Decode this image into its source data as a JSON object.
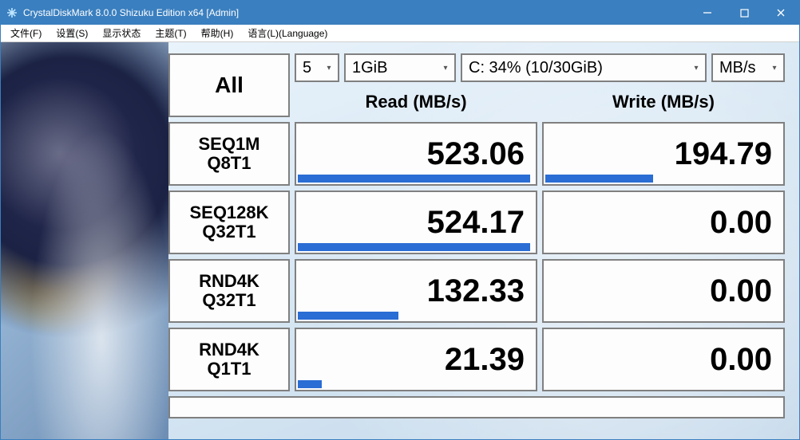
{
  "window": {
    "title": "CrystalDiskMark 8.0.0 Shizuku Edition x64 [Admin]"
  },
  "menus": {
    "file": "文件(F)",
    "settings": "设置(S)",
    "display": "显示状态",
    "theme": "主题(T)",
    "help": "帮助(H)",
    "language": "语言(L)(Language)"
  },
  "controls": {
    "all": "All",
    "runs": "5",
    "size": "1GiB",
    "drive": "C: 34% (10/30GiB)",
    "unit": "MB/s"
  },
  "headers": {
    "read": "Read (MB/s)",
    "write": "Write (MB/s)"
  },
  "tests": [
    {
      "label1": "SEQ1M",
      "label2": "Q8T1",
      "read": "523.06",
      "write": "194.79",
      "rbar": 97,
      "wbar": 45
    },
    {
      "label1": "SEQ128K",
      "label2": "Q32T1",
      "read": "524.17",
      "write": "0.00",
      "rbar": 97,
      "wbar": 0
    },
    {
      "label1": "RND4K",
      "label2": "Q32T1",
      "read": "132.33",
      "write": "0.00",
      "rbar": 42,
      "wbar": 0
    },
    {
      "label1": "RND4K",
      "label2": "Q1T1",
      "read": "21.39",
      "write": "0.00",
      "rbar": 10,
      "wbar": 0
    }
  ],
  "chart_data": {
    "type": "table",
    "title": "CrystalDiskMark 8.0.0 Benchmark Results",
    "drive": "C: 34% (10/30GiB)",
    "runs": 5,
    "test_size": "1GiB",
    "unit": "MB/s",
    "columns": [
      "Test",
      "Read (MB/s)",
      "Write (MB/s)"
    ],
    "rows": [
      [
        "SEQ1M Q8T1",
        523.06,
        194.79
      ],
      [
        "SEQ128K Q32T1",
        524.17,
        0.0
      ],
      [
        "RND4K Q32T1",
        132.33,
        0.0
      ],
      [
        "RND4K Q1T1",
        21.39,
        0.0
      ]
    ]
  }
}
